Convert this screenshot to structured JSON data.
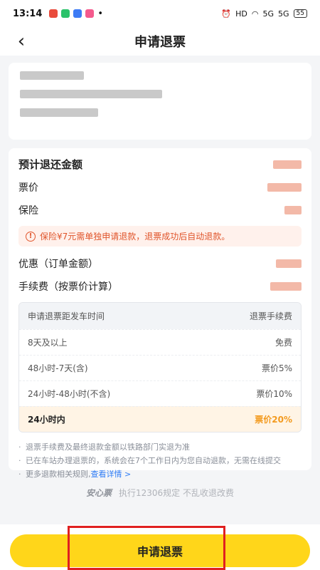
{
  "status_bar": {
    "time": "13:14",
    "network": "HD",
    "signal_1": "5G",
    "signal_2": "5G",
    "battery": "55"
  },
  "nav": {
    "title": "申请退票"
  },
  "refund": {
    "estimated_label": "预计退还金额",
    "price_label": "票价",
    "insurance_label": "保险",
    "notice": "保险¥7元需单独申请退款，退票成功后自动退款。",
    "discount_label": "优惠（订单金额）",
    "fee_label": "手续费（按票价计算）"
  },
  "fee_table": {
    "header_left": "申请退票距发车时间",
    "header_right": "退票手续费",
    "rows": [
      {
        "time": "8天及以上",
        "fee": "免费"
      },
      {
        "time": "48小时-7天(含)",
        "fee": "票价5%"
      },
      {
        "time": "24小时-48小时(不含)",
        "fee": "票价10%"
      },
      {
        "time": "24小时内",
        "fee": "票价20%"
      }
    ]
  },
  "notes": {
    "note1": "退票手续费及最终退款金额以铁路部门实退为准",
    "note2": "已在车站办理退票的，系统会在7个工作日内为您自动退款，无需在线提交",
    "note3_prefix": "更多退款相关规则,",
    "note3_link": "查看详情 >"
  },
  "footer": {
    "brand": "安心票",
    "text": "执行12306规定 不乱收退改费"
  },
  "action": {
    "apply_label": "申请退票"
  },
  "colors": {
    "accent_yellow": "#ffd61a",
    "alert_orange": "#e0552b",
    "highlight_orange": "#f39a1e",
    "link_blue": "#2f7df6",
    "annotation_red": "#e02020"
  }
}
